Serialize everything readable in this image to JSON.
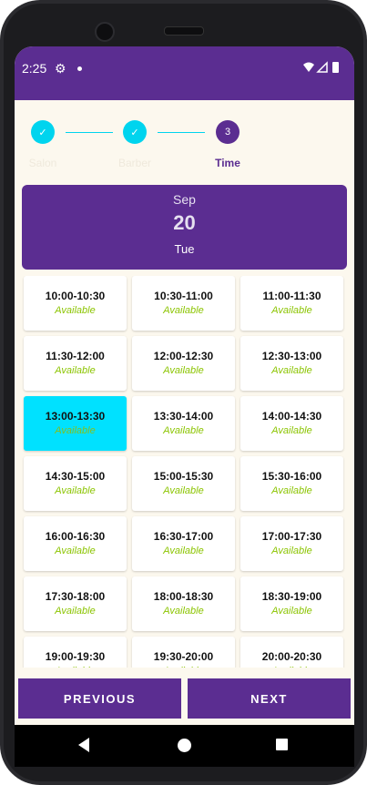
{
  "status_bar": {
    "time": "2:25",
    "icons": [
      "settings-icon",
      "notification-dot-icon",
      "wifi-icon",
      "signal-icon",
      "battery-icon"
    ]
  },
  "stepper": {
    "steps": [
      {
        "label": "Salon",
        "state": "completed",
        "icon": "check-icon"
      },
      {
        "label": "Barber",
        "state": "completed",
        "icon": "check-icon"
      },
      {
        "label": "Time",
        "number": "3",
        "state": "active"
      }
    ]
  },
  "date": {
    "month": "Sep",
    "day": "20",
    "weekday": "Tue"
  },
  "slots": [
    {
      "time": "10:00-10:30",
      "status": "Available",
      "selected": false
    },
    {
      "time": "10:30-11:00",
      "status": "Available",
      "selected": false
    },
    {
      "time": "11:00-11:30",
      "status": "Available",
      "selected": false
    },
    {
      "time": "11:30-12:00",
      "status": "Available",
      "selected": false
    },
    {
      "time": "12:00-12:30",
      "status": "Available",
      "selected": false
    },
    {
      "time": "12:30-13:00",
      "status": "Available",
      "selected": false
    },
    {
      "time": "13:00-13:30",
      "status": "Available",
      "selected": true
    },
    {
      "time": "13:30-14:00",
      "status": "Available",
      "selected": false
    },
    {
      "time": "14:00-14:30",
      "status": "Available",
      "selected": false
    },
    {
      "time": "14:30-15:00",
      "status": "Available",
      "selected": false
    },
    {
      "time": "15:00-15:30",
      "status": "Available",
      "selected": false
    },
    {
      "time": "15:30-16:00",
      "status": "Available",
      "selected": false
    },
    {
      "time": "16:00-16:30",
      "status": "Available",
      "selected": false
    },
    {
      "time": "16:30-17:00",
      "status": "Available",
      "selected": false
    },
    {
      "time": "17:00-17:30",
      "status": "Available",
      "selected": false
    },
    {
      "time": "17:30-18:00",
      "status": "Available",
      "selected": false
    },
    {
      "time": "18:00-18:30",
      "status": "Available",
      "selected": false
    },
    {
      "time": "18:30-19:00",
      "status": "Available",
      "selected": false
    },
    {
      "time": "19:00-19:30",
      "status": "Available",
      "selected": false
    },
    {
      "time": "19:30-20:00",
      "status": "Available",
      "selected": false
    },
    {
      "time": "20:00-20:30",
      "status": "Available",
      "selected": false
    }
  ],
  "buttons": {
    "previous": "PREVIOUS",
    "next": "NEXT"
  },
  "colors": {
    "primary": "#5b2d91",
    "accent": "#00d4ee",
    "selected_slot": "#00e1ff",
    "available_text": "#8bc400",
    "background": "#fcf8ee"
  }
}
